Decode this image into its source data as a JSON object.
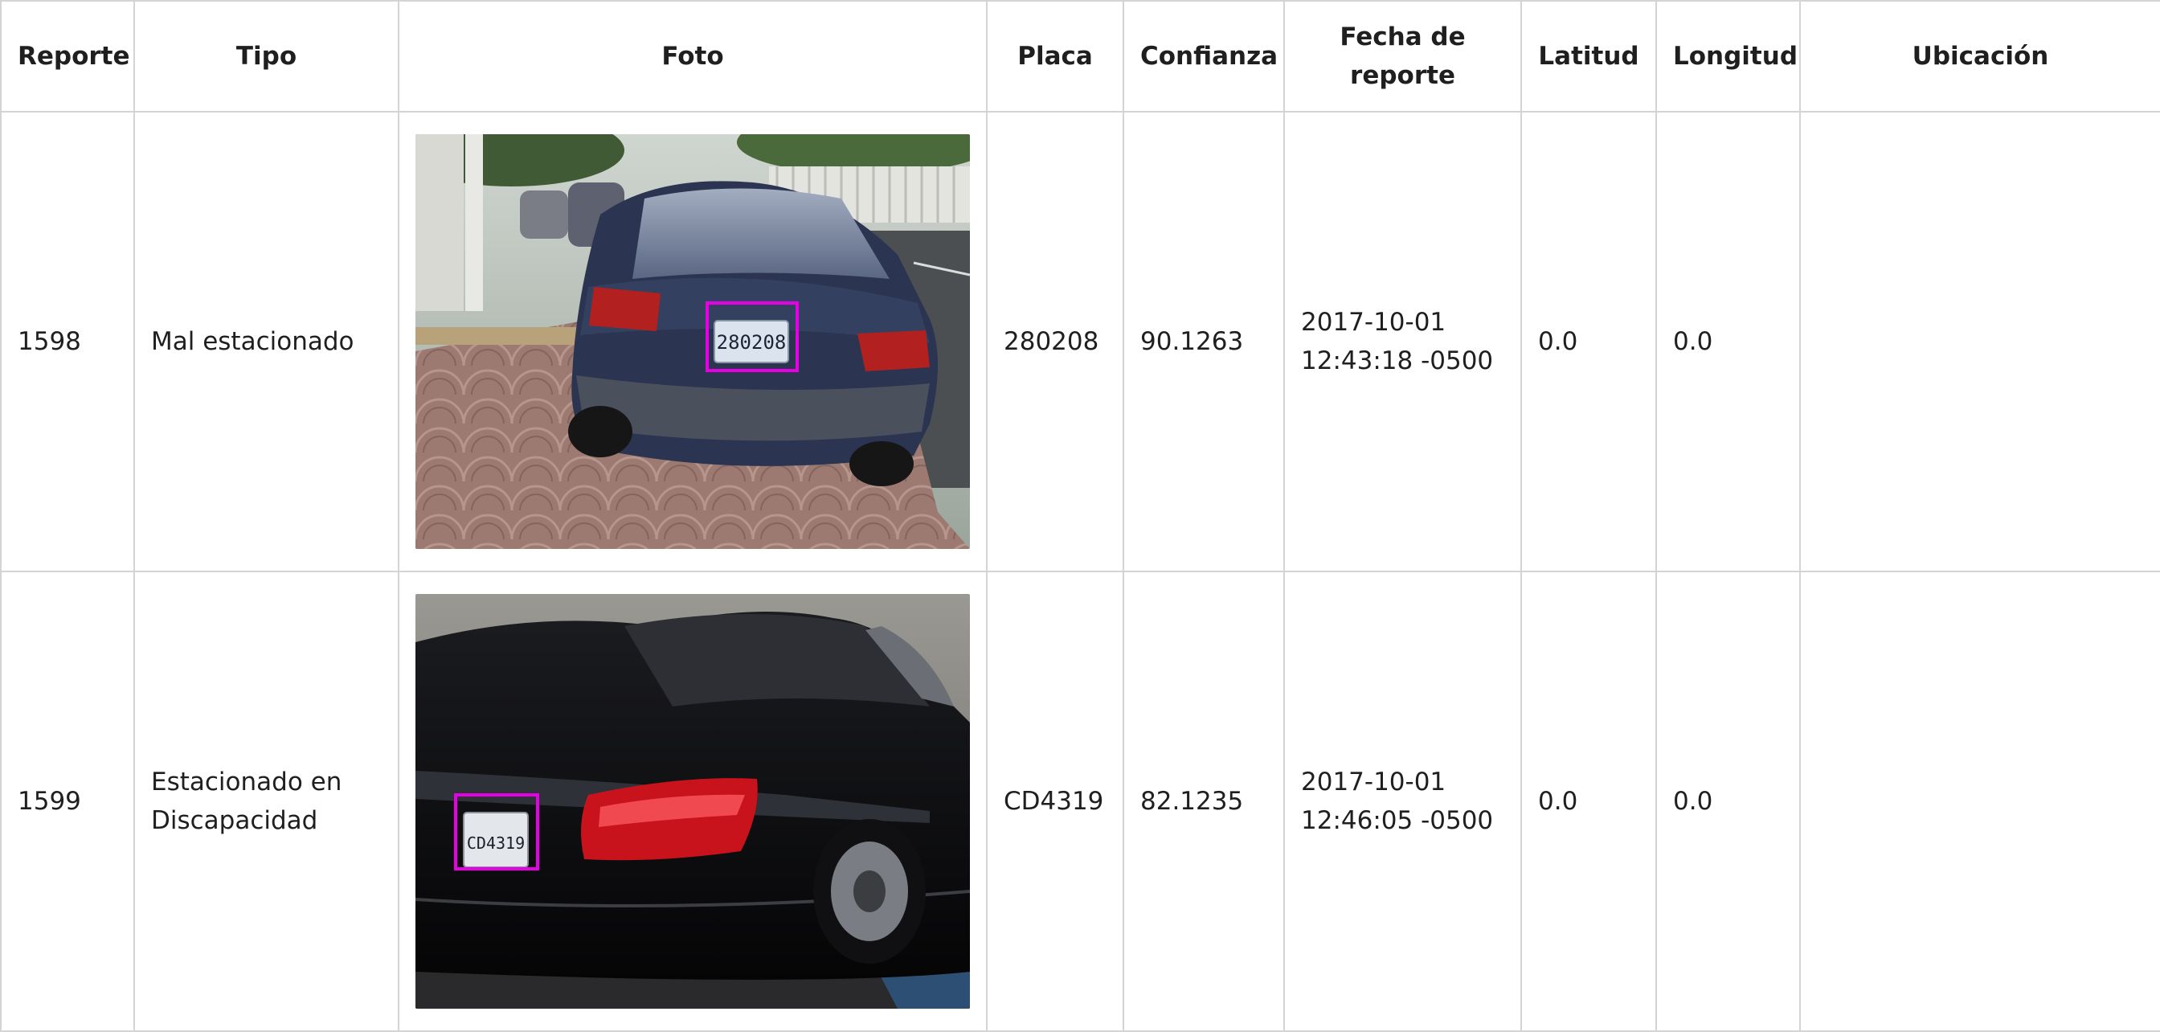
{
  "table": {
    "headers": {
      "reporte": "Reporte",
      "tipo": "Tipo",
      "foto": "Foto",
      "placa": "Placa",
      "confianza": "Confianza",
      "fecha": "Fecha de\nreporte",
      "latitud": "Latitud",
      "longitud": "Longitud",
      "ubicacion": "Ubicación"
    },
    "rows": [
      {
        "reporte": "1598",
        "tipo": "Mal estacionado",
        "photo_plate": "280208",
        "placa": "280208",
        "confianza": "90.1263",
        "fecha": "2017-10-01\n12:43:18 -0500",
        "latitud": "0.0",
        "longitud": "0.0",
        "ubicacion": ""
      },
      {
        "reporte": "1599",
        "tipo": "Estacionado en\nDiscapacidad",
        "photo_plate": "CD4319",
        "placa": "CD4319",
        "confianza": "82.1235",
        "fecha": "2017-10-01\n12:46:05 -0500",
        "latitud": "0.0",
        "longitud": "0.0",
        "ubicacion": ""
      }
    ]
  },
  "colors": {
    "detection_box": "#e600e6",
    "grid_border": "#d4d4d4",
    "car1_body": "#2b3450",
    "car2_body": "#0c0c0e"
  }
}
